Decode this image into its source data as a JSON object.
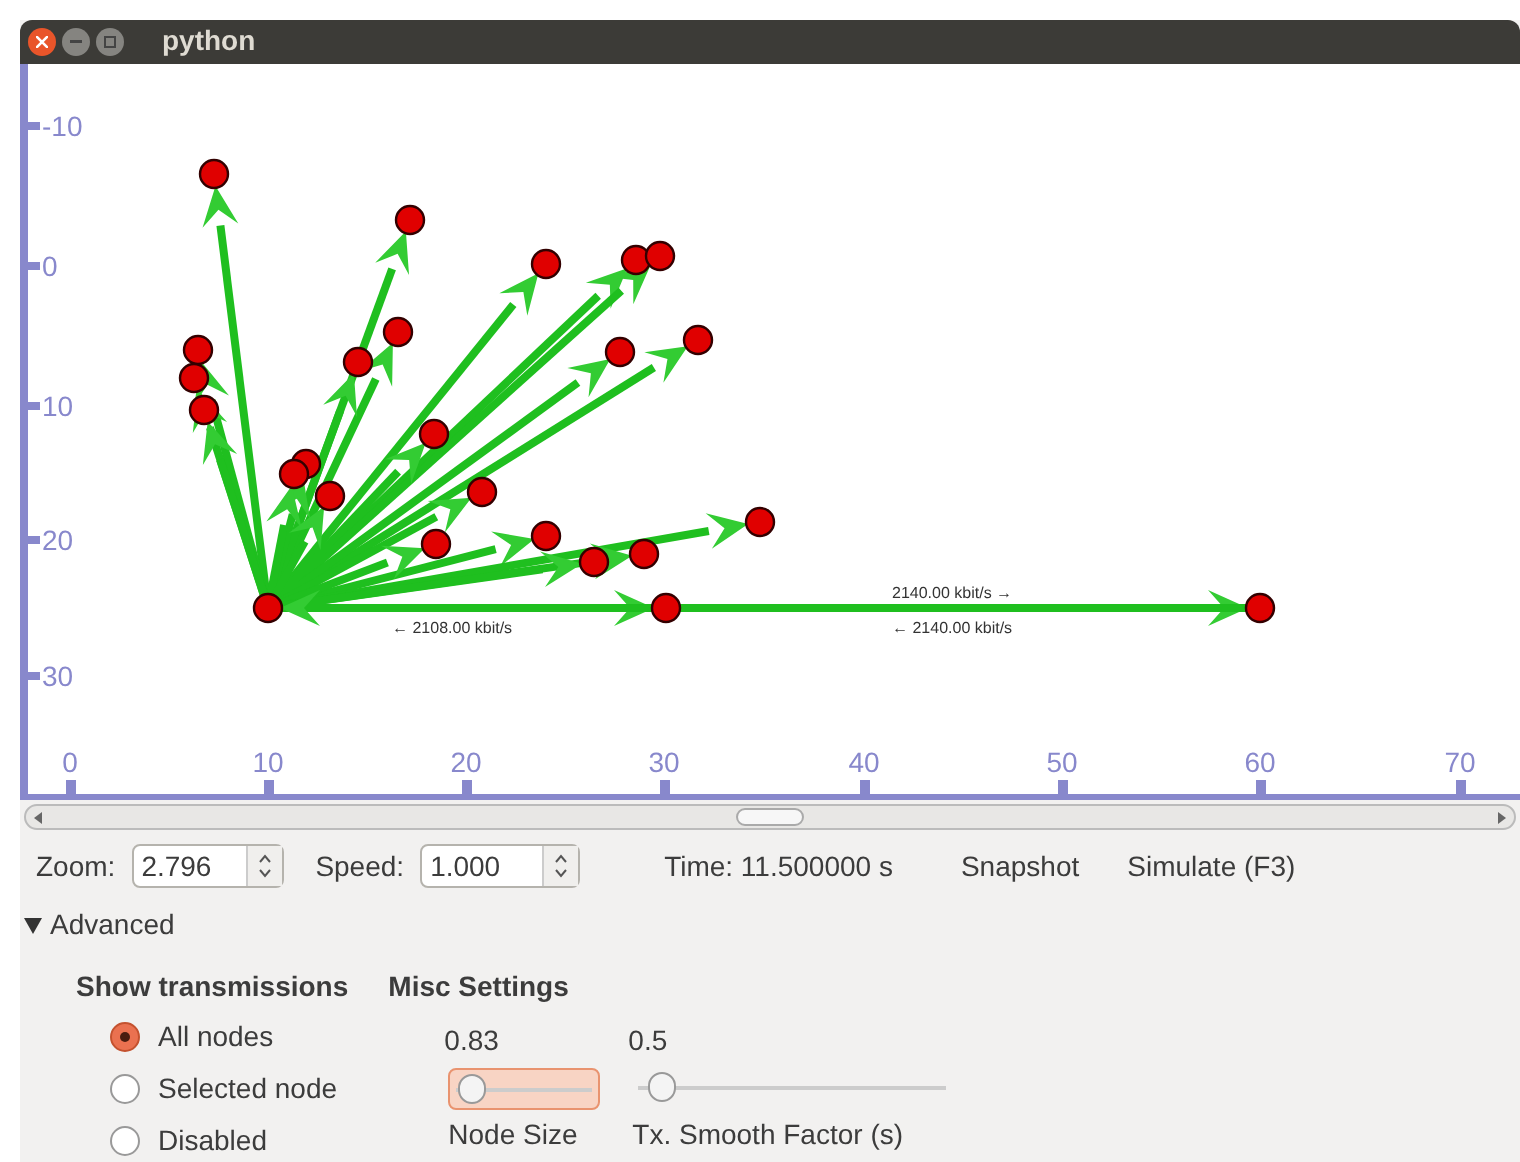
{
  "window": {
    "title": "python"
  },
  "canvas": {
    "y_ticks": [
      "-10",
      "0",
      "10",
      "20",
      "30"
    ],
    "x_ticks": [
      "0",
      "10",
      "20",
      "30",
      "40",
      "50",
      "60",
      "70"
    ],
    "link_labels": [
      {
        "text": "2140.00 kbit/s →",
        "kind": "upper"
      },
      {
        "text": "← 2108.00 kbit/s",
        "kind": "lower"
      },
      {
        "text": "← 2140.00 kbit/s",
        "kind": "lower"
      }
    ]
  },
  "toolbar": {
    "zoom": {
      "label": "Zoom:",
      "value": "2.796"
    },
    "speed": {
      "label": "Speed:",
      "value": "1.000"
    },
    "time": "Time: 11.500000 s",
    "buttons": [
      "Snapshot",
      "Simulate (F3)"
    ]
  },
  "advanced": {
    "label": "Advanced",
    "expanded": true,
    "show_transmissions": {
      "title": "Show transmissions",
      "options": [
        {
          "label": "All nodes",
          "selected": true
        },
        {
          "label": "Selected node",
          "selected": false
        },
        {
          "label": "Disabled",
          "selected": false
        }
      ]
    },
    "misc_settings": {
      "title": "Misc Settings",
      "sliders": [
        {
          "reading": "0.83",
          "label": "Node Size",
          "level": 0.05,
          "focused": true
        },
        {
          "reading": "0.5",
          "label": "Tx. Smooth Factor (s)",
          "level": 0.05,
          "focused": false
        }
      ]
    }
  }
}
